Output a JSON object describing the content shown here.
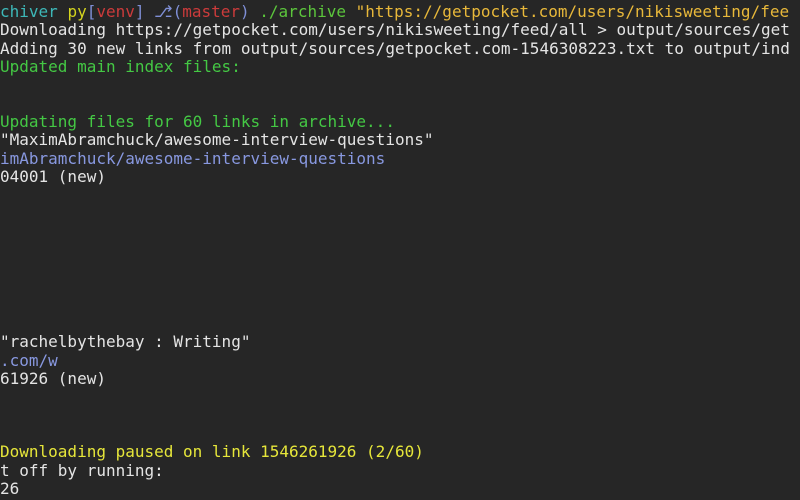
{
  "colors": {
    "background": "#262626",
    "text": "#e4e4e4",
    "cyan": "#3db8b8",
    "py": "#d4d41e",
    "venv": "#cc3b3b",
    "branch_icon": "#7f8fd6",
    "branch": "#cc3b3b",
    "paren": "#7f8fd6",
    "command": "#5cc63c",
    "string": "#e8b83a",
    "green": "#44c844",
    "blue": "#8898e0",
    "yellow": "#e6e63a"
  },
  "lines": [
    {
      "row": 0,
      "segments": [
        {
          "text": "chiver ",
          "color": "cyan"
        },
        {
          "text": "py",
          "color": "py"
        },
        {
          "text": "[",
          "color": "paren"
        },
        {
          "text": "venv",
          "color": "venv"
        },
        {
          "text": "] ",
          "color": "paren"
        },
        {
          "text": "⎇",
          "color": "branch_icon"
        },
        {
          "text": "(",
          "color": "paren"
        },
        {
          "text": "master",
          "color": "branch"
        },
        {
          "text": ") ",
          "color": "paren"
        },
        {
          "text": "./archive ",
          "color": "command"
        },
        {
          "text": "\"https://getpocket.com/users/nikisweeting/fee",
          "color": "string"
        }
      ]
    },
    {
      "row": 1,
      "segments": [
        {
          "text": "Downloading https://getpocket.com/users/nikisweeting/feed/all > output/sources/get",
          "color": "text"
        }
      ]
    },
    {
      "row": 2,
      "segments": [
        {
          "text": "Adding 30 new links from output/sources/getpocket.com-1546308223.txt to output/ind",
          "color": "text"
        }
      ]
    },
    {
      "row": 3,
      "segments": [
        {
          "text": "Updated main index files:",
          "color": "green"
        }
      ]
    },
    {
      "row": 6,
      "segments": [
        {
          "text": "Updating files for 60 links in archive...",
          "color": "green"
        }
      ]
    },
    {
      "row": 7,
      "segments": [
        {
          "text": "\"MaximAbramchuck/awesome-interview-questions\"",
          "color": "text"
        }
      ]
    },
    {
      "row": 8,
      "segments": [
        {
          "text": "imAbramchuck/awesome-interview-questions",
          "color": "blue"
        }
      ]
    },
    {
      "row": 9,
      "segments": [
        {
          "text": "04001 (new)",
          "color": "text"
        }
      ]
    },
    {
      "row": 18,
      "segments": [
        {
          "text": "\"rachelbythebay : Writing\"",
          "color": "text"
        }
      ]
    },
    {
      "row": 19,
      "segments": [
        {
          "text": ".com/w",
          "color": "blue"
        }
      ]
    },
    {
      "row": 20,
      "segments": [
        {
          "text": "61926 (new)",
          "color": "text"
        }
      ]
    },
    {
      "row": 24,
      "segments": [
        {
          "text": "Downloading paused on link 1546261926 (2/60)",
          "color": "yellow"
        }
      ]
    },
    {
      "row": 25,
      "segments": [
        {
          "text": "t off by running:",
          "color": "text"
        }
      ]
    },
    {
      "row": 26,
      "segments": [
        {
          "text": "26",
          "color": "text"
        }
      ]
    }
  ]
}
